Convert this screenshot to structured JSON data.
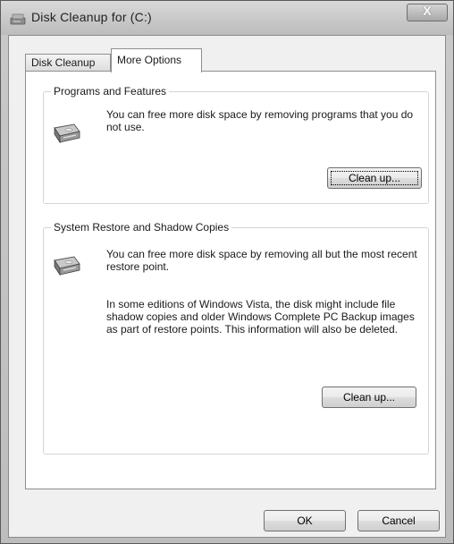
{
  "window": {
    "title": "Disk Cleanup for  (C:)",
    "close_label": "X"
  },
  "tabs": [
    {
      "label": "Disk Cleanup",
      "active": false
    },
    {
      "label": "More Options",
      "active": true
    }
  ],
  "programs": {
    "title": "Programs and Features",
    "description": "You can free more disk space by removing programs that you do not use.",
    "button_label": "Clean up..."
  },
  "restore": {
    "title": "System Restore and Shadow Copies",
    "description": "You can free more disk space by removing all but the most recent restore point.",
    "note": "In some editions of Windows Vista, the disk might include file shadow copies and older Windows Complete PC Backup images as part of restore points. This information will also be deleted.",
    "button_label": "Clean up..."
  },
  "footer": {
    "ok_label": "OK",
    "cancel_label": "Cancel"
  },
  "icons": {
    "title": "disk-cleanup-icon",
    "programs": "hard-drive-icon",
    "restore": "hard-drive-icon"
  }
}
